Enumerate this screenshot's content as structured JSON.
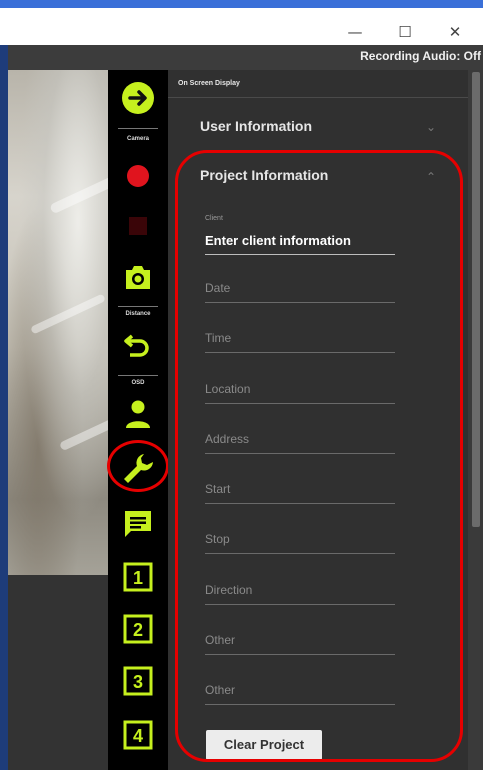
{
  "window": {
    "minimize_glyph": "—",
    "maximize_glyph": "☐",
    "close_glyph": "✕"
  },
  "status": {
    "recording_text": "Recording Audio: Off"
  },
  "toolbar": {
    "accent_color": "#c6f01e",
    "labels": {
      "camera": "Camera",
      "distance": "Distance",
      "osd": "OSD"
    },
    "icons": [
      "arrow-right-circle-icon",
      "record-icon",
      "stop-icon",
      "camera-icon",
      "undo-icon",
      "person-icon",
      "wrench-icon",
      "comment-icon",
      "preset-1-icon",
      "preset-2-icon",
      "preset-3-icon",
      "preset-4-icon"
    ],
    "presets": [
      "1",
      "2",
      "3",
      "4"
    ]
  },
  "panel": {
    "title": "On Screen Display",
    "user_info": {
      "label": "User Information",
      "expanded": false
    },
    "project_info": {
      "label": "Project Information",
      "expanded": true,
      "client_label": "Client",
      "client_value": "Enter client information",
      "fields": [
        "Date",
        "Time",
        "Location",
        "Address",
        "Start",
        "Stop",
        "Direction",
        "Other",
        "Other"
      ]
    },
    "clear_button": "Clear Project"
  },
  "annotations": {
    "color": "#e60000"
  }
}
